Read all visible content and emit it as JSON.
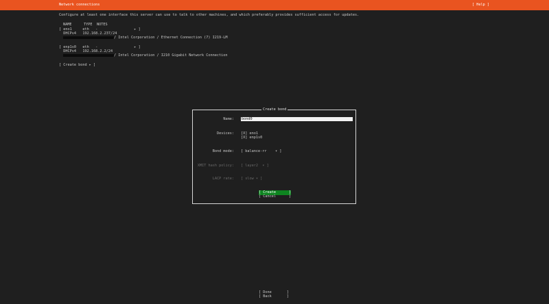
{
  "header": {
    "title": "Network connections",
    "help_label": "[ Help ]"
  },
  "intro": "Configure at least one interface this server can use to talk to other machines, and which preferably provides sufficient access for updates.",
  "table_headers": {
    "name": "NAME",
    "type": "TYPE",
    "notes": "NOTES"
  },
  "interfaces": [
    {
      "row": "[ eno1     eth   -                 ▸ ]",
      "dhcp": "  DHCPv4   192.168.2.237/24",
      "desc": "/ Intel Corporation / Ethernet Connection (7) I219-LM"
    },
    {
      "row": "[ enp1s0   eth   -                 ▸ ]",
      "dhcp": "  DHCPv4   192.168.2.2/24",
      "desc": "/ Intel Corporation / I210 Gigabit Network Connection"
    }
  ],
  "create_bond_link": "[ Create bond ▸ ]",
  "dialog": {
    "title": "Create bond",
    "name_label": "Name:",
    "name_value": "bond0",
    "devices_label": "Devices:",
    "devices": [
      "[X] eno1",
      "[X] enp1s0"
    ],
    "bond_mode_label": "Bond mode:",
    "bond_mode_value": "[ balance-rr    ▾ ]",
    "xmit_label": "XMIT hash policy:",
    "xmit_value": "[ layer2  ▾ ]",
    "lacp_label": "LACP rate:",
    "lacp_value": "[ slow ▾ ]",
    "create_label": "[ Create      ]",
    "cancel_label": "[ Cancel      ]"
  },
  "footer": {
    "done_label": "[ Done       ]",
    "back_label": "[ Back       ]"
  }
}
